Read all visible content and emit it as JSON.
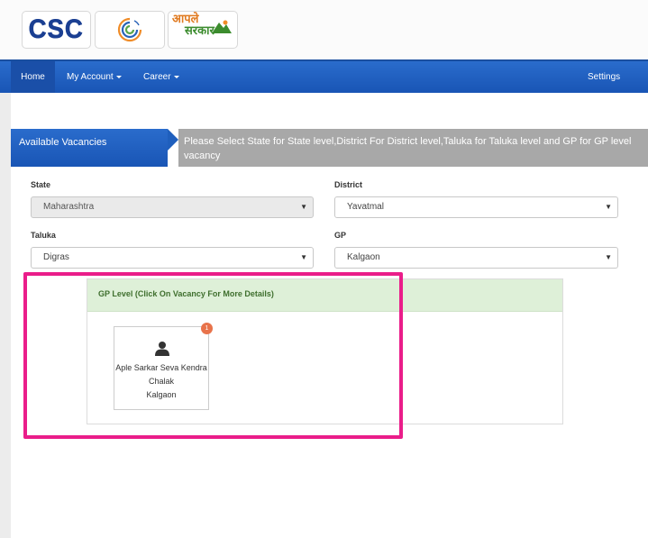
{
  "logos": {
    "csc": "CSC",
    "apale_line1": "आपले",
    "apale_line2": "सरकार"
  },
  "nav": {
    "home": "Home",
    "my_account": "My Account",
    "career": "Career",
    "settings": "Settings"
  },
  "vacancies": {
    "title": "Available Vacancies",
    "note": "Please Select State for State level,District For District level,Taluka for Taluka level and GP for GP level vacancy"
  },
  "filters": {
    "state": {
      "label": "State",
      "value": "Maharashtra"
    },
    "district": {
      "label": "District",
      "value": "Yavatmal"
    },
    "taluka": {
      "label": "Taluka",
      "value": "Digras"
    },
    "gp": {
      "label": "GP",
      "value": "Kalgaon"
    }
  },
  "gp_level": {
    "heading": "GP Level (Click On Vacancy For More Details)",
    "card": {
      "badge": "1",
      "line1": "Aple Sarkar Seva Kendra",
      "line2": "Chalak",
      "line3": "Kalgaon"
    }
  },
  "colors": {
    "nav_blue": "#1f5fbd",
    "gp_header_green": "#def0d8",
    "highlight_pink": "#ea1d8a",
    "badge_orange": "#e8734b"
  }
}
